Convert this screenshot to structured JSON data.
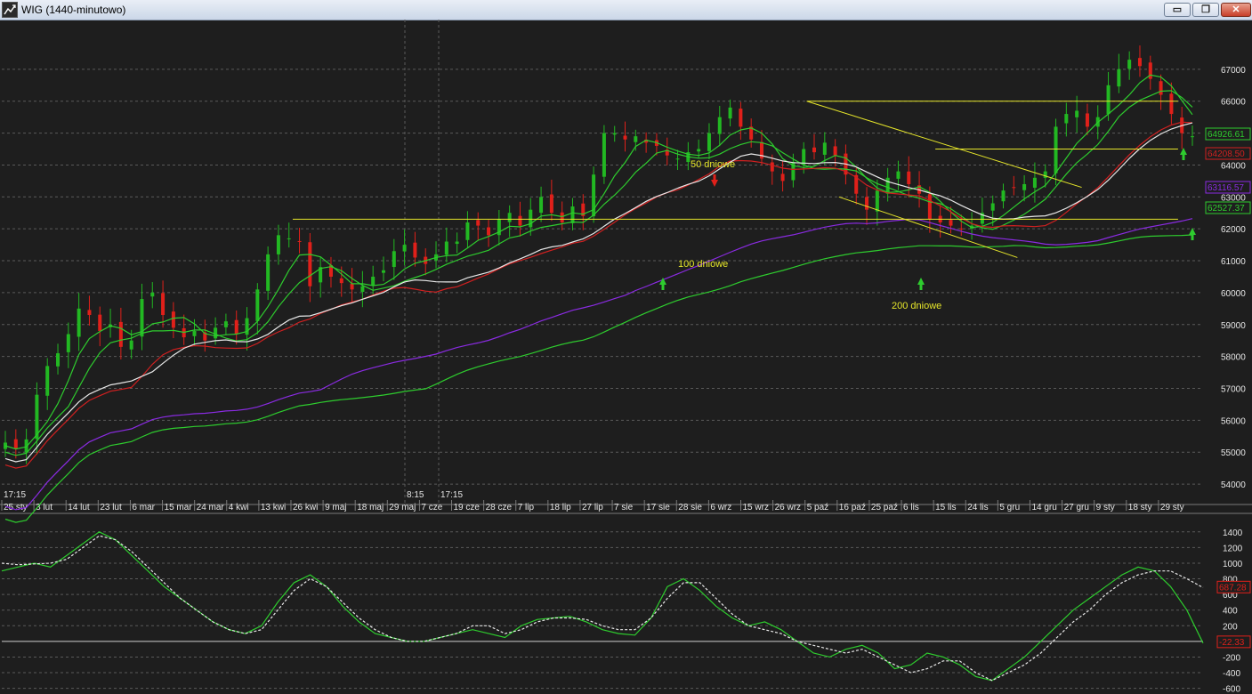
{
  "window": {
    "title": "WIG (1440-minutowo)",
    "minimize_label": "▭",
    "restore_label": "❐",
    "close_label": "✕"
  },
  "colors": {
    "background": "#1e1e1e",
    "grid": "#5a5a5a",
    "up_candle": "#22b822",
    "down_candle": "#e0201a",
    "ma50": "#2ecc2e",
    "ma100": "#d02020",
    "ma200": "#2ecc2e",
    "white_ma": "#e8e8e8",
    "purple_ma": "#8a2be2",
    "trendline": "#e6e62a",
    "axis_text": "#e6e6e6",
    "annotation_text": "#e6e62a"
  },
  "chart_data": [
    {
      "type": "candlestick",
      "title": "WIG (1440-minutowo)",
      "ylim": [
        53500,
        68000
      ],
      "y_ticks": [
        54000,
        55000,
        56000,
        57000,
        58000,
        59000,
        60000,
        61000,
        62000,
        63000,
        64000,
        65000,
        66000,
        67000
      ],
      "x_tick_labels": [
        "25 sty",
        "3 lut",
        "14 lut",
        "23 lut",
        "6 mar",
        "15 mar",
        "24 mar",
        "4 kwi",
        "13 kwi",
        "26 kwi",
        "9 maj",
        "18 maj",
        "29 maj",
        "7 cze",
        "19 cze",
        "28 cze",
        "7 lip",
        "18 lip",
        "27 lip",
        "7 sie",
        "17 sie",
        "28 sie",
        "6 wrz",
        "15 wrz",
        "26 wrz",
        "5 paź",
        "16 paź",
        "25 paź",
        "6 lis",
        "15 lis",
        "24 lis",
        "5 gru",
        "14 gru",
        "27 gru",
        "9 sty",
        "18 sty",
        "29 sty"
      ],
      "time_labels": [
        "17:15",
        "8:15",
        "17:15"
      ],
      "close_series": [
        55300,
        55100,
        55400,
        56800,
        57700,
        58100,
        58700,
        59500,
        59300,
        58800,
        59000,
        58300,
        58500,
        59800,
        60000,
        59300,
        58900,
        58600,
        58800,
        58500,
        58900,
        59100,
        58700,
        59200,
        60100,
        61200,
        61800,
        61700,
        61600,
        60200,
        60800,
        60500,
        60300,
        60100,
        60200,
        60500,
        60700,
        61300,
        61500,
        61100,
        60900,
        61200,
        61600,
        61600,
        62200,
        62100,
        61800,
        62300,
        62500,
        62100,
        62600,
        63000,
        62500,
        62200,
        62700,
        62400,
        63700,
        65000,
        65000,
        64800,
        64900,
        64700,
        64600,
        64300,
        64200,
        64400,
        64500,
        65000,
        65500,
        65800,
        65200,
        64800,
        64200,
        63800,
        63500,
        64100,
        64500,
        64400,
        64700,
        64300,
        63700,
        63100,
        62600,
        63200,
        63600,
        63800,
        63400,
        63100,
        62300,
        62200,
        62100,
        62000,
        62100,
        62500,
        62800,
        63200,
        63300,
        63400,
        63600,
        63800,
        65200,
        65600,
        65700,
        65200,
        65500,
        66500,
        67000,
        67300,
        67100,
        66700,
        66200,
        65600,
        65000,
        64900
      ],
      "moving_averages": [
        {
          "name": "50 dniowe",
          "last_value": "64926.61"
        },
        {
          "name": "",
          "last_value": "64208.50"
        },
        {
          "name": "100 dniowe",
          "last_value": "63116.57"
        },
        {
          "name": "200 dniowe",
          "last_value": "62527.37"
        }
      ],
      "trendlines": [
        {
          "from": [
            "5 paź",
            66000
          ],
          "to": [
            "29 sty",
            66000
          ]
        },
        {
          "from": [
            "26 kwi",
            62300
          ],
          "to": [
            "29 sty",
            62300
          ]
        },
        {
          "from": [
            "5 paź",
            66000
          ],
          "to": [
            "27 gru",
            63300
          ]
        },
        {
          "from": [
            "16 paź",
            63000
          ],
          "to": [
            "5 gru",
            61100
          ]
        },
        {
          "from": [
            "15 lis",
            64500
          ],
          "to": [
            "29 sty",
            64500
          ]
        }
      ],
      "annotations": [
        {
          "text": "50 dniowe",
          "arrow": "down",
          "color": "red"
        },
        {
          "text": "100 dniowe",
          "arrow": "up",
          "color": "green"
        },
        {
          "text": "200 dniowe",
          "arrow": "up",
          "color": "green"
        }
      ]
    },
    {
      "type": "line",
      "title": "",
      "ylim": [
        -650,
        1500
      ],
      "y_ticks": [
        -600,
        -400,
        -200,
        0,
        200,
        400,
        600,
        800,
        1000,
        1200,
        1400
      ],
      "series": [
        {
          "name": "",
          "values": [
            900,
            950,
            1000,
            950,
            1100,
            1250,
            1400,
            1300,
            1100,
            900,
            700,
            550,
            400,
            250,
            150,
            100,
            200,
            500,
            750,
            850,
            700,
            450,
            250,
            100,
            50,
            0,
            0,
            50,
            100,
            150,
            100,
            50,
            200,
            280,
            300,
            320,
            250,
            150,
            100,
            80,
            300,
            700,
            800,
            650,
            450,
            300,
            200,
            250,
            150,
            0,
            -150,
            -200,
            -100,
            -50,
            -150,
            -350,
            -300,
            -150,
            -200,
            -300,
            -450,
            -500,
            -350,
            -200,
            0,
            200,
            400,
            550,
            700,
            850,
            950,
            900,
            700,
            400,
            -22.33
          ],
          "last_value": "-22.33"
        },
        {
          "name": "",
          "values": [
            1000,
            980,
            990,
            1000,
            1050,
            1200,
            1350,
            1300,
            1150,
            950,
            750,
            550,
            400,
            250,
            150,
            100,
            150,
            400,
            650,
            800,
            700,
            500,
            300,
            150,
            50,
            0,
            0,
            50,
            100,
            200,
            200,
            100,
            150,
            250,
            300,
            300,
            280,
            200,
            150,
            150,
            300,
            550,
            750,
            750,
            550,
            350,
            200,
            150,
            100,
            0,
            -50,
            -100,
            -150,
            -100,
            -200,
            -300,
            -400,
            -350,
            -250,
            -250,
            -400,
            -500,
            -400,
            -300,
            -150,
            50,
            250,
            400,
            600,
            750,
            850,
            900,
            900,
            800,
            687.28
          ],
          "last_value": "687.28"
        }
      ]
    }
  ]
}
